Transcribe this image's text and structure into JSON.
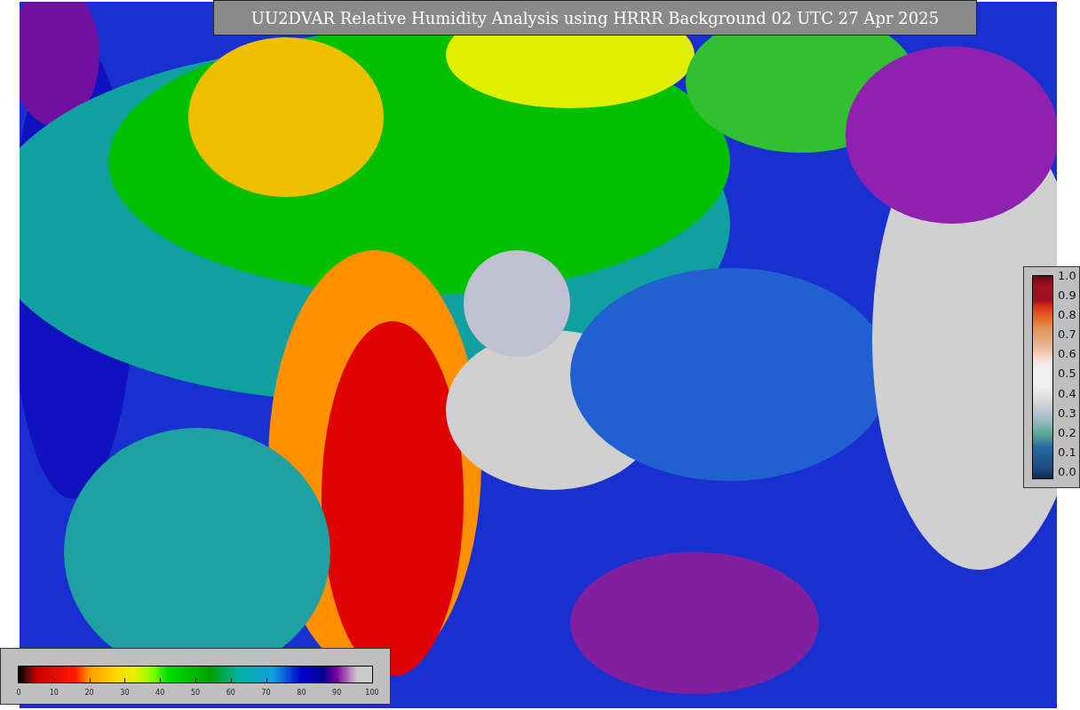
{
  "title": "UU2DVAR Relative Humidity Analysis using HRRR Background 02 UTC 27 Apr 2025",
  "humidity_colorbar": {
    "ticks": [
      "0",
      "10",
      "20",
      "30",
      "40",
      "50",
      "60",
      "70",
      "80",
      "90",
      "100"
    ]
  },
  "ratio_colorbar": {
    "ticks": [
      "1.0",
      "0.9",
      "0.8",
      "0.7",
      "0.6",
      "0.5",
      "0.4",
      "0.3",
      "0.2",
      "0.1",
      "0.0"
    ]
  }
}
